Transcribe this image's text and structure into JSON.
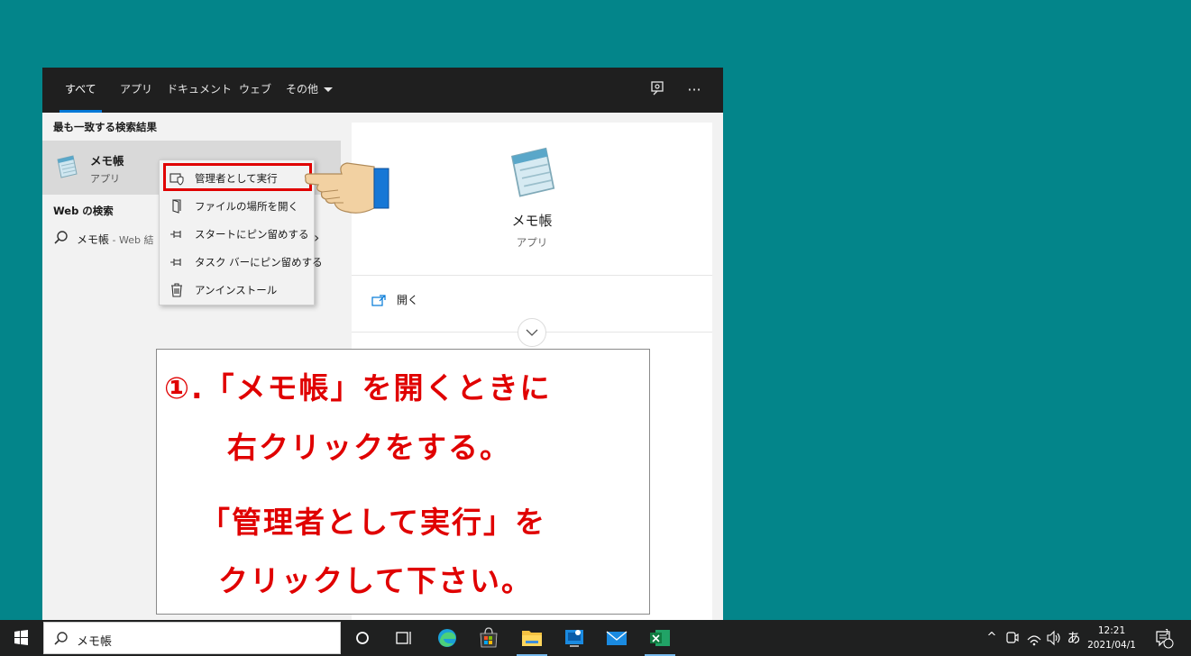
{
  "tabs": [
    "すべて",
    "アプリ",
    "ドキュメント",
    "ウェブ",
    "その他"
  ],
  "left": {
    "best_match_header": "最も一致する検索結果",
    "best": {
      "name": "メモ帳",
      "kind": "アプリ"
    },
    "web_header": "Web の検索",
    "web_query": "メモ帳",
    "web_suffix": " - Web 結"
  },
  "context_menu": [
    "管理者として実行",
    "ファイルの場所を開く",
    "スタートにピン留めする",
    "タスク バーにピン留めする",
    "アンインストール"
  ],
  "right": {
    "title": "メモ帳",
    "sub": "アプリ",
    "open_label": "開く"
  },
  "note": {
    "line1": "①.「メモ帳」を開くときに",
    "line2": "右クリックをする。",
    "line3": "「管理者として実行」を",
    "line4": "クリックして下さい。"
  },
  "taskbar": {
    "search_text": "メモ帳",
    "ime": "あ",
    "time": "12:21",
    "date": "2021/04/1",
    "notification_count": "1"
  },
  "colors": {
    "desktop": "#03858a",
    "accent": "#0078d7",
    "highlight": "#e00000"
  }
}
